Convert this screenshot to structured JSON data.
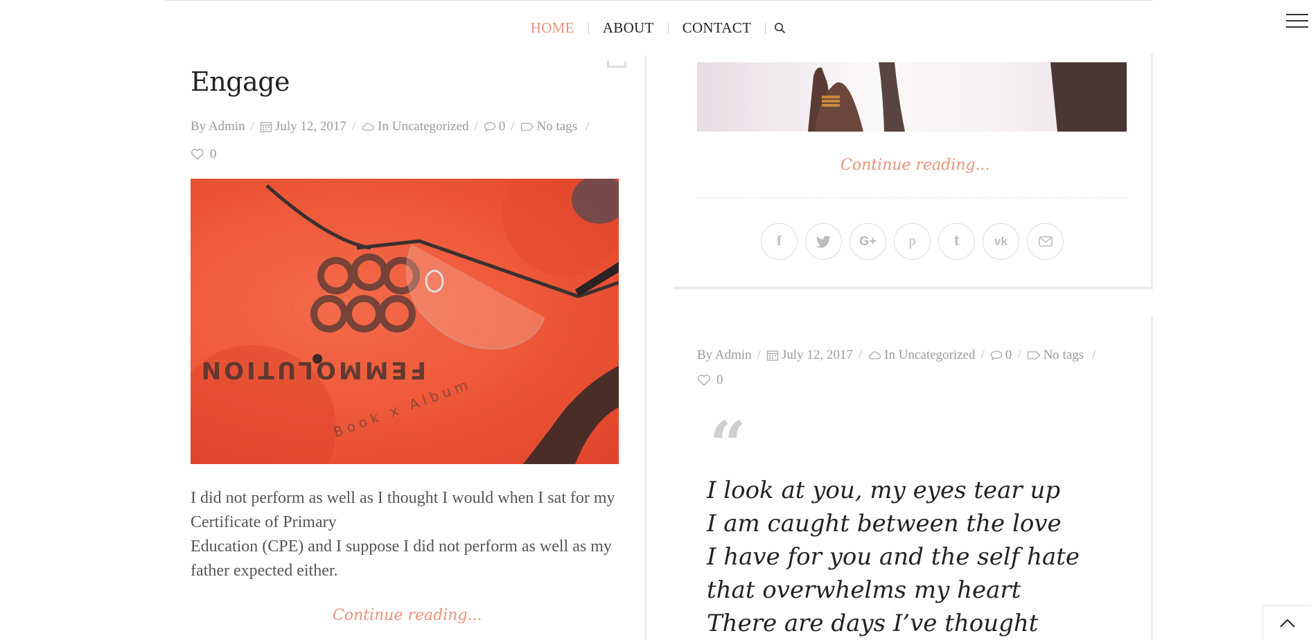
{
  "nav": {
    "items": [
      {
        "label": "HOME",
        "active": true
      },
      {
        "label": "ABOUT",
        "active": false
      },
      {
        "label": "CONTACT",
        "active": false
      }
    ],
    "search_icon": "search-icon",
    "menu_icon": "hamburger-menu-icon",
    "accent_color": "#e8927c"
  },
  "left_post": {
    "title": "Engage",
    "meta": {
      "author": "By Admin",
      "date": "July 12, 2017",
      "category": "In Uncategorized",
      "comments": "0",
      "tags": "No tags",
      "likes": "0"
    },
    "excerpt_lines": [
      "I did not perform as well as I thought I would when I sat for my Certificate of Primary",
      "Education (CPE) and I suppose I did not perform as well as my father expected either."
    ],
    "continue": "Continue reading..."
  },
  "right_top": {
    "continue": "Continue reading...",
    "share_icons": [
      "facebook-icon",
      "twitter-icon",
      "google-plus-icon",
      "pinterest-icon",
      "tumblr-icon",
      "vk-icon",
      "email-icon"
    ]
  },
  "right_post": {
    "meta": {
      "author": "By Admin",
      "date": "July 12, 2017",
      "category": "In Uncategorized",
      "comments": "0",
      "tags": "No tags",
      "likes": "0"
    },
    "quote_mark": "“",
    "quote_lines": [
      "I look at you, my eyes tear up",
      "I am caught between the love",
      "I have for you and the self hate",
      "that overwhelms my heart",
      "There are days I’ve thought"
    ]
  },
  "photo_left_text": {
    "ring_text": "FEMMOLUTION",
    "sub_text": "Book x Album"
  }
}
